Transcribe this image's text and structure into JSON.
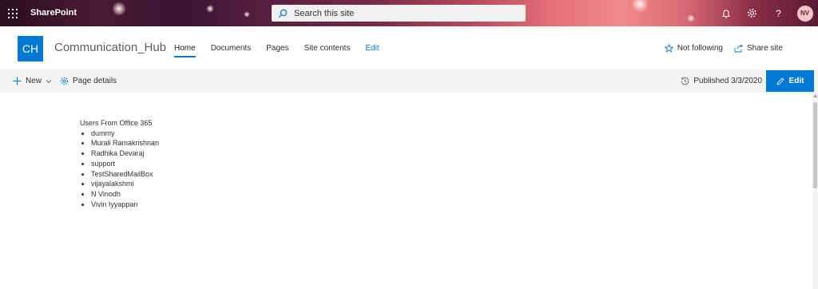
{
  "suitebar": {
    "brand": "SharePoint",
    "search_placeholder": "Search this site",
    "user_initials": "NV",
    "icons": [
      "waffle-icon",
      "search-icon",
      "bell-icon",
      "gear-icon",
      "help-icon"
    ]
  },
  "site": {
    "logo_text": "CH",
    "title": "Communication_Hub",
    "nav": [
      {
        "label": "Home",
        "active": true
      },
      {
        "label": "Documents",
        "active": false
      },
      {
        "label": "Pages",
        "active": false
      },
      {
        "label": "Site contents",
        "active": false
      },
      {
        "label": "Edit",
        "active": false
      }
    ],
    "not_following_label": "Not following",
    "share_site_label": "Share site"
  },
  "commandbar": {
    "new_label": "New",
    "page_details_label": "Page details",
    "published_label": "Published 3/3/2020",
    "edit_label": "Edit"
  },
  "content": {
    "heading": "Users From Office 365",
    "users": [
      "dummy",
      "Murali Ramakrishnan",
      "Radhika Devaraj",
      "support",
      "TestSharedMailBox",
      "vijayalakshmi",
      "N Vinodh",
      "Vivin Iyyappan"
    ]
  },
  "colors": {
    "accent": "#0078d4",
    "command_bar_bg": "#f4f4f4",
    "text": "#323130"
  }
}
